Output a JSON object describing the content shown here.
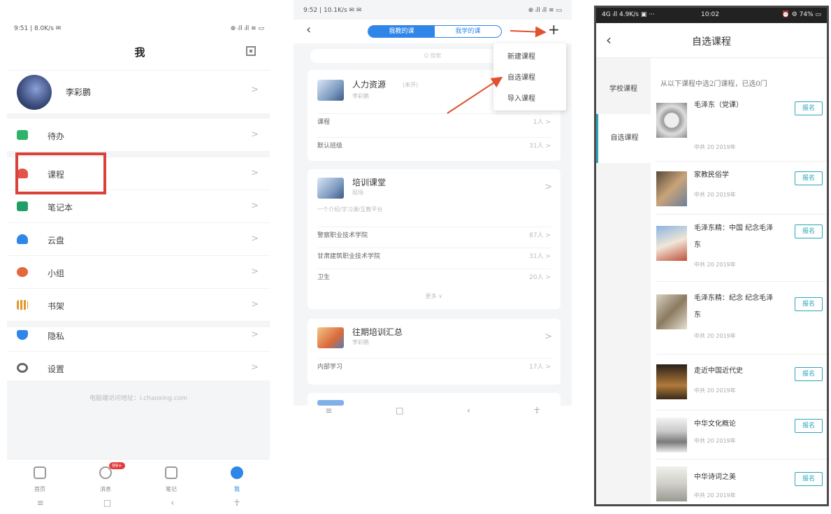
{
  "screen1": {
    "status_left": "9:51 | 8.0K/s ✉",
    "status_right": "⊕ ᵢll ᵢll ≋ ▭",
    "title": "我",
    "profile_name": "李彩鹏",
    "menu": [
      {
        "label": "待办",
        "icon": "todo-icon",
        "color": "#2fb36a"
      },
      {
        "label": "课程",
        "icon": "course-icon",
        "color": "#e2534a"
      },
      {
        "label": "笔记本",
        "icon": "notebook-icon",
        "color": "#1f9e6a"
      },
      {
        "label": "云盘",
        "icon": "cloud-icon",
        "color": "#2f86e8"
      },
      {
        "label": "小组",
        "icon": "group-icon",
        "color": "#e2683a"
      },
      {
        "label": "书架",
        "icon": "bookshelf-icon",
        "color": "#e0972b"
      },
      {
        "label": "隐私",
        "icon": "shield-icon",
        "color": "#2f86e8"
      },
      {
        "label": "设置",
        "icon": "gear-icon",
        "color": "#666666"
      }
    ],
    "weburl": "电脑端访问地址：i.chaoxing.com",
    "tabs": [
      {
        "label": "首页",
        "icon": "home-icon"
      },
      {
        "label": "消息",
        "icon": "message-icon",
        "badge": "99+"
      },
      {
        "label": "笔记",
        "icon": "note-icon"
      },
      {
        "label": "我",
        "icon": "profile-icon"
      }
    ]
  },
  "screen2": {
    "status_left": "9:52 | 10.1K/s ✉ ✉",
    "status_right": "⊕ ᵢll ᵢll ≋ ▭",
    "seg_teach": "我教的课",
    "seg_learn": "我学的课",
    "search_placeholder": "Q 搜索",
    "dropdown": [
      "新建课程",
      "自选课程",
      "导入课程"
    ],
    "cards": [
      {
        "title": "人力资源",
        "tag": "(未开)",
        "sub": "李彩鹏",
        "rows": [
          {
            "label": "课程",
            "value": "1人 >"
          },
          {
            "label": "默认班级",
            "value": "31人 >"
          }
        ]
      },
      {
        "title": "培训课堂",
        "sub": "现场",
        "desc": "一个介绍/学习课/互教平台",
        "rows": [
          {
            "label": "警察职业技术学院",
            "value": "87人 >"
          },
          {
            "label": "甘肃建筑职业技术学院",
            "value": "31人 >"
          },
          {
            "label": "卫生",
            "value": "20人 >"
          }
        ],
        "more": "更多 ∨"
      },
      {
        "title": "往期培训汇总",
        "sub": "李彩鹏",
        "rows": [
          {
            "label": "内部学习",
            "value": "17人 >"
          }
        ]
      }
    ]
  },
  "screen3": {
    "status_left": "4G ᵢll 4.9K/s ▣ ···",
    "status_time": "10:02",
    "status_right": "⏰ ⚙ 74% ▭",
    "title": "自选课程",
    "sidebar": [
      "学校课程",
      "自选课程"
    ],
    "hint": "从以下课程中选2门课程，已选0门",
    "courses": [
      {
        "name": "毛泽东（党课）",
        "meta": "中共 20 2019年",
        "button": "报名"
      },
      {
        "name": "家教民俗学",
        "meta": "中共 20 2019年",
        "button": "报名"
      },
      {
        "name": "毛泽东精：中国 纪念毛泽东",
        "meta": "中共 20 2019年",
        "button": "报名"
      },
      {
        "name": "毛泽东精：纪念 纪念毛泽东",
        "meta": "中共 20 2019年",
        "button": "报名"
      },
      {
        "name": "走近中国近代史",
        "meta": "中共 20 2019年",
        "button": "报名"
      },
      {
        "name": "中华文化概论",
        "meta": "中共 20 2019年",
        "button": "报名"
      },
      {
        "name": "中华诗词之美",
        "meta": "中共 20 2019年",
        "button": "报名"
      }
    ]
  },
  "colors": {
    "accent": "#2f86e8",
    "highlight": "#d9413a",
    "teal": "#2aa6b8",
    "arrow": "#e0512f"
  }
}
